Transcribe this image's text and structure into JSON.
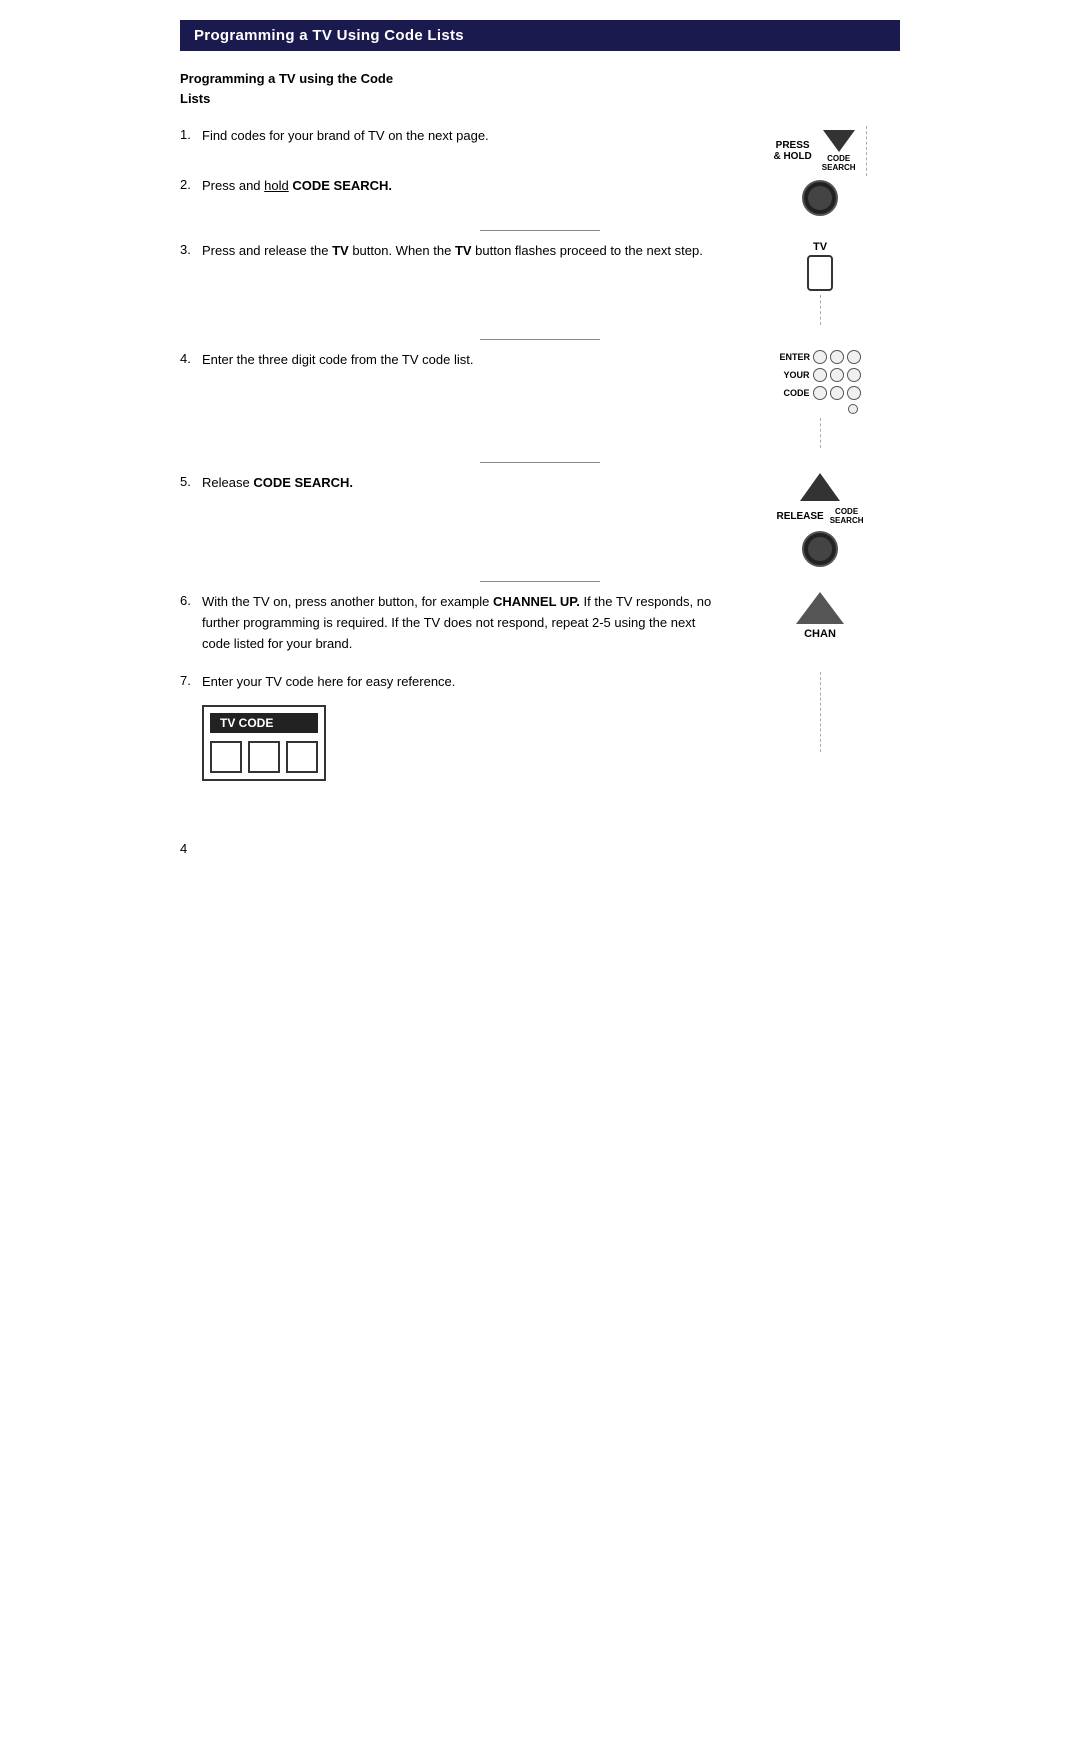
{
  "page": {
    "title": "Programming a TV Using Code Lists",
    "intro": {
      "line1": "Programming a TV using the Code",
      "line2": "Lists"
    },
    "steps": [
      {
        "number": "1.",
        "text": "Find codes for your brand of TV on the next page.",
        "visual": "press-hold"
      },
      {
        "number": "2.",
        "text_prefix": "Press and ",
        "text_underline": "hold",
        "text_suffix": " ",
        "text_bold": "CODE SEARCH.",
        "visual": "circle-button"
      },
      {
        "number": "3.",
        "text_prefix": "Press and release the ",
        "text_bold1": "TV",
        "text_mid": " button. When the ",
        "text_bold2": "TV",
        "text_suffix": " button flashes proceed to the next step.",
        "visual": "tv-button"
      },
      {
        "number": "4.",
        "text_prefix": "Enter the three digit code from the TV code list.",
        "text_labels": [
          "ENTER",
          "YOUR",
          "CODE"
        ],
        "visual": "keypad"
      },
      {
        "number": "5.",
        "text_prefix": "Release ",
        "text_bold": "CODE SEARCH.",
        "visual": "release-up"
      },
      {
        "number": "6.",
        "text_prefix": "With the TV on, press another button, for example ",
        "text_bold": "CHANNEL UP.",
        "text_suffix": " If the TV responds, no further programming is required. If the TV does not respond, repeat 2-5 using the next code listed for your brand.",
        "visual": "chan-up"
      },
      {
        "number": "7.",
        "text": "Enter your TV code here for easy reference.",
        "visual": "tv-code-box"
      }
    ],
    "labels": {
      "press": "PRESS",
      "and_hold": "& HOLD",
      "code_search": "CODE\nSEARCH",
      "tv": "TV",
      "enter": "ENTER",
      "your": "YOUR",
      "code": "CODE",
      "release": "RELEASE",
      "code_search2": "CODE\nSEARCH",
      "chan": "CHAN",
      "tv_code": "TV CODE"
    },
    "page_number": "4"
  }
}
